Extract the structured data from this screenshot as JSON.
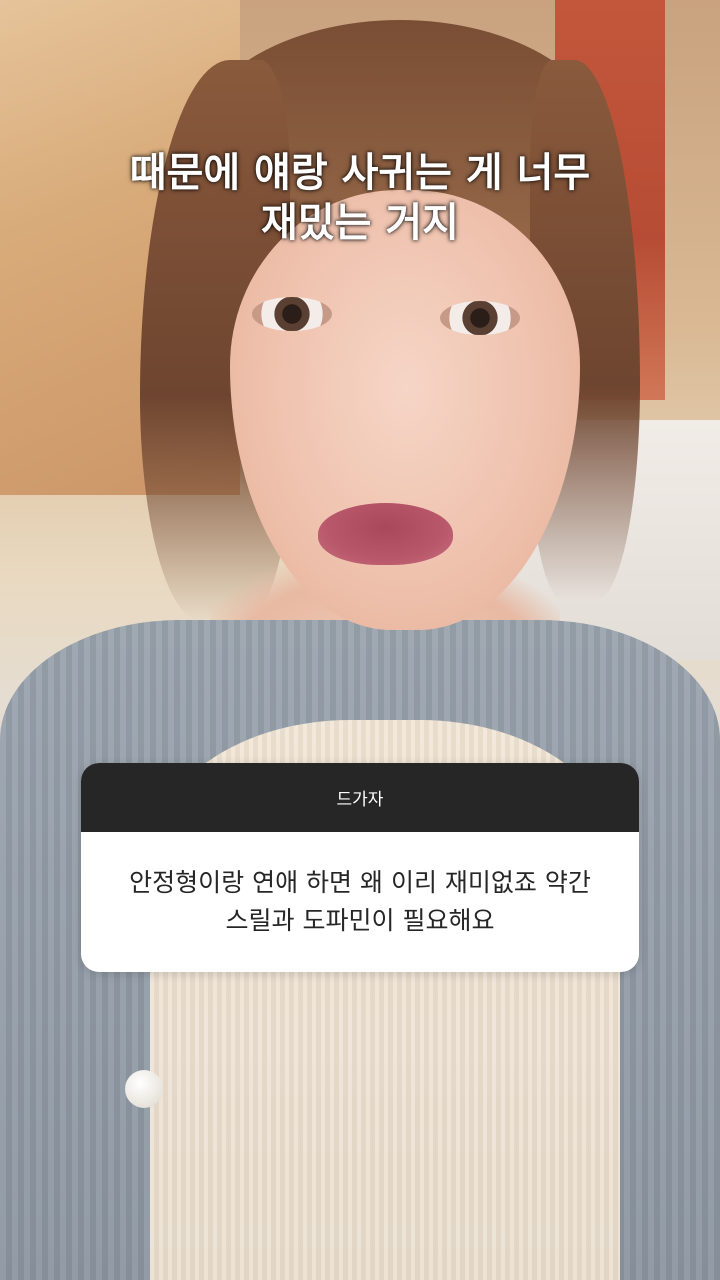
{
  "caption": {
    "text": "때문에 얘랑 사귀는 게 너무\n재밌는 거지"
  },
  "question_sticker": {
    "header": "드가자",
    "question": "안정형이랑 연애 하면 왜 이리 재미없죠 약간\n스릴과 도파민이 필요해요"
  }
}
